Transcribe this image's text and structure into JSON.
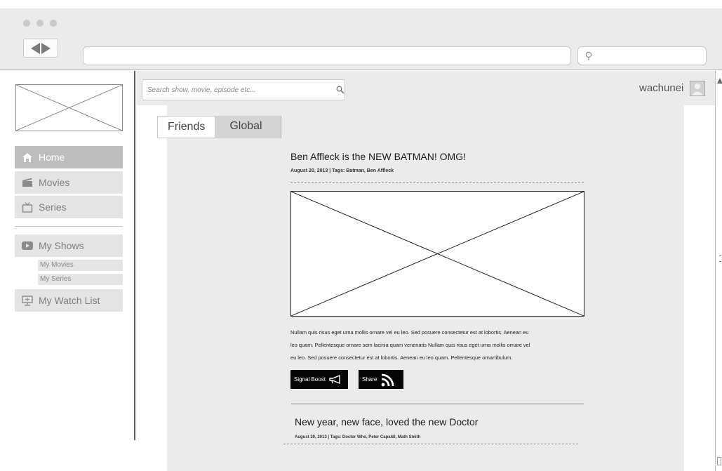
{
  "window": {
    "url": "",
    "browser_search_value": ""
  },
  "sidebar": {
    "items": [
      {
        "label": "Home",
        "icon": "home-icon",
        "active": true
      },
      {
        "label": "Movies",
        "icon": "clapperboard-icon",
        "active": false
      },
      {
        "label": "Series",
        "icon": "tv-icon",
        "active": false
      },
      {
        "label": "My Shows",
        "icon": "play-icon",
        "active": false
      },
      {
        "label": "My Watch List",
        "icon": "monitor-icon",
        "active": false
      }
    ],
    "subitems": [
      {
        "label": "My Movies"
      },
      {
        "label": "My Series"
      }
    ]
  },
  "header": {
    "search_placeholder": "Search show, movie, episode etc...",
    "username": "wachunei"
  },
  "tabs": [
    {
      "label": "Friends",
      "active": true
    },
    {
      "label": "Global",
      "active": false
    }
  ],
  "posts": [
    {
      "title": "Ben Affleck is the NEW BATMAN! OMG!",
      "meta": "August 20, 2013 | Tags: Batman, Ben Affleck",
      "body_lines": [
        "Nullam quis risus eget urna mollis ornare vel eu leo. Sed posuere consectetur est at lobortis. Aenean eu",
        "leo quam. Pellentesque ornare sem lacinia quam venenatis Nullam quis risus eget urna mollis ornare vel",
        "eu leo. Sed posuere consectetur est at lobortis. Aenean eu leo quam. Pellentesque ornartibulum."
      ],
      "signal_boost_label": "Signal Boost",
      "share_label": "Share"
    },
    {
      "title": "New year, new face, loved the new Doctor",
      "meta": "August 20, 2013 | Tags: Doctor Who, Peter Capaldi, Math Smith"
    }
  ],
  "colors": {
    "chrome": "#ebebeb",
    "active_nav": "#bdbdbd",
    "nav_item": "#e4e4e4",
    "button": "#050505"
  }
}
